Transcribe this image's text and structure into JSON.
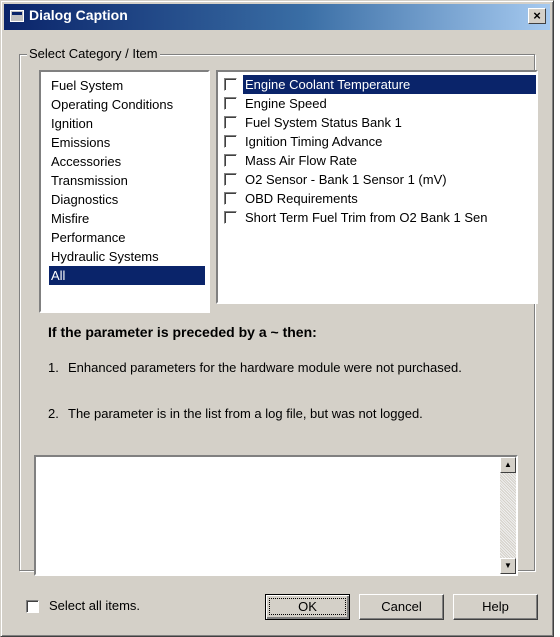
{
  "window": {
    "title": "Dialog Caption",
    "close_glyph": "×"
  },
  "group": {
    "label": "Select Category / Item"
  },
  "categories": [
    "Fuel System",
    "Operating Conditions",
    "Ignition",
    "Emissions",
    "Accessories",
    "Transmission",
    "Diagnostics",
    "Misfire",
    "Performance",
    "Hydraulic Systems",
    "All"
  ],
  "selected_category": "All",
  "parameters": [
    {
      "label": "Engine Coolant Temperature",
      "checked": false,
      "selected": true
    },
    {
      "label": "Engine Speed",
      "checked": false
    },
    {
      "label": "Fuel System Status Bank 1",
      "checked": false
    },
    {
      "label": "Ignition Timing Advance",
      "checked": false
    },
    {
      "label": "Mass Air Flow Rate",
      "checked": false
    },
    {
      "label": "O2 Sensor - Bank 1 Sensor 1 (mV)",
      "checked": false
    },
    {
      "label": "OBD Requirements",
      "checked": false
    },
    {
      "label": "Short Term Fuel Trim from O2 Bank 1 Sen",
      "checked": false
    }
  ],
  "notes": {
    "heading": "If the parameter is preceded by a  ~  then:",
    "items": [
      {
        "num": "1.",
        "text": "Enhanced parameters for the hardware module were not purchased."
      },
      {
        "num": "2.",
        "text": "The parameter is in the list from a log file, but was not logged."
      }
    ]
  },
  "info_box": {
    "text": ""
  },
  "scroll": {
    "up": "▲",
    "down": "▼"
  },
  "footer": {
    "select_all_label": "Select all items.",
    "select_all_checked": false,
    "ok_label": "OK",
    "cancel_label": "Cancel",
    "help_label": "Help"
  },
  "colors": {
    "selection": "#0a246a",
    "face": "#d4d0c8"
  },
  "icons": {
    "title": "window-app-icon"
  }
}
